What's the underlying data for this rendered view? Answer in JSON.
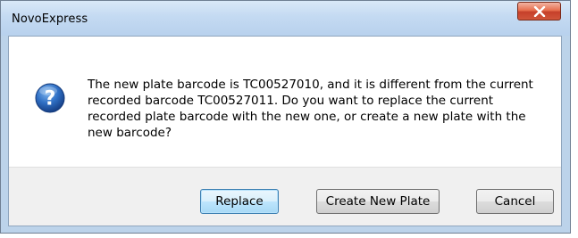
{
  "window": {
    "title": "NovoExpress",
    "close_symbol": "✕"
  },
  "message": {
    "icon": "question-icon",
    "text": "The new plate barcode is TC00527010, and it is different from the current recorded barcode TC00527011. Do you want to replace the current recorded plate barcode with the new one, or create a new plate with the new barcode?"
  },
  "buttons": {
    "replace_label": "Replace",
    "create_label": "Create New Plate",
    "cancel_label": "Cancel"
  },
  "colors": {
    "close_button": "#c6402a",
    "default_button_border": "#3c7fb1",
    "question_icon": "#1f5fb4"
  }
}
